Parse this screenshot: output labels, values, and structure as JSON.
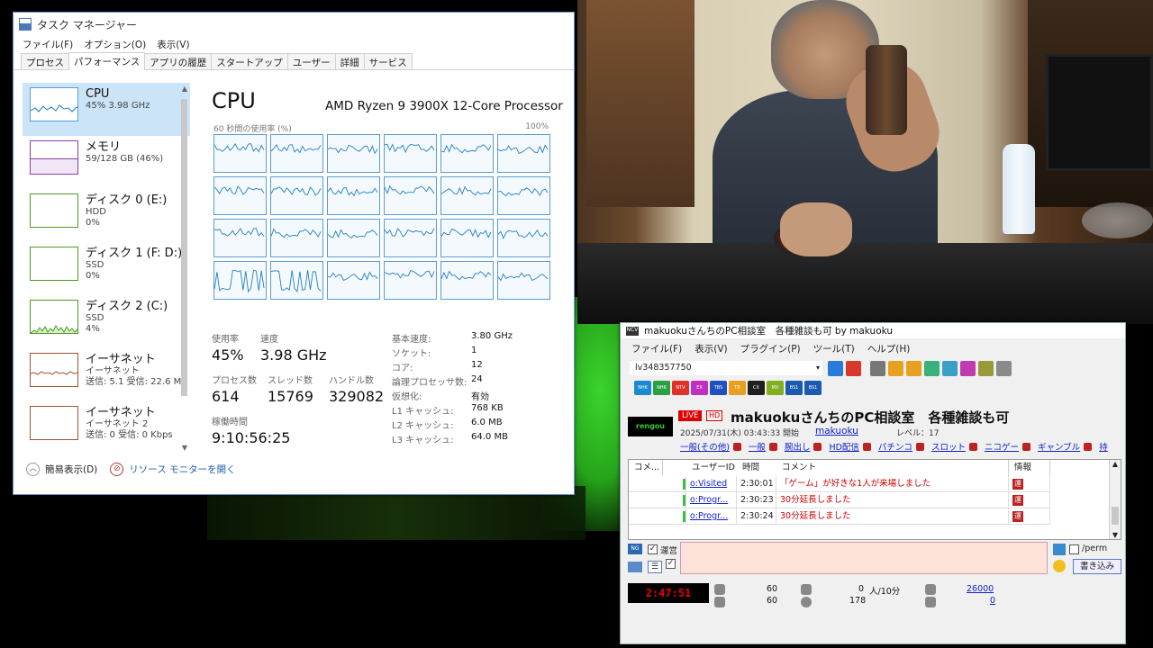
{
  "task_manager": {
    "title": "タスク マネージャー",
    "menu": [
      "ファイル(F)",
      "オプション(O)",
      "表示(V)"
    ],
    "tabs": [
      "プロセス",
      "パフォーマンス",
      "アプリの履歴",
      "スタートアップ",
      "ユーザー",
      "詳細",
      "サービス"
    ],
    "active_tab": "パフォーマンス",
    "sidebar": [
      {
        "title": "CPU",
        "sub1": "45%  3.98 GHz",
        "sub2": "",
        "sub3": "",
        "color": "#1f7ac0"
      },
      {
        "title": "メモリ",
        "sub1": "59/128 GB (46%)",
        "sub2": "",
        "sub3": "",
        "color": "#8b3ea8"
      },
      {
        "title": "ディスク 0 (E:)",
        "sub1": "HDD",
        "sub2": "0%",
        "sub3": "",
        "color": "#4b9a1f"
      },
      {
        "title": "ディスク 1 (F: D:)",
        "sub1": "SSD",
        "sub2": "0%",
        "sub3": "",
        "color": "#4b9a1f"
      },
      {
        "title": "ディスク 2 (C:)",
        "sub1": "SSD",
        "sub2": "4%",
        "sub3": "",
        "color": "#4b9a1f"
      },
      {
        "title": "イーサネット",
        "sub1": "イーサネット",
        "sub2": "送信: 5.1  受信: 22.6 M",
        "sub3": "",
        "color": "#a0522d"
      },
      {
        "title": "イーサネット",
        "sub1": "イーサネット 2",
        "sub2": "送信: 0  受信: 0 Kbps",
        "sub3": "",
        "color": "#a0522d"
      }
    ],
    "cpu": {
      "heading": "CPU",
      "processor": "AMD Ryzen 9 3900X 12-Core Processor",
      "graph_label": "60 秒間の使用率 (%)",
      "graph_max": "100%",
      "usage_label": "使用率",
      "usage": "45%",
      "speed_label": "速度",
      "speed": "3.98 GHz",
      "process_label": "プロセス数",
      "processes": "614",
      "thread_label": "スレッド数",
      "threads": "15769",
      "handle_label": "ハンドル数",
      "handles": "329082",
      "uptime_label": "稼働時間",
      "uptime": "9:10:56:25",
      "specs": [
        {
          "k": "基本速度:",
          "v": "3.80 GHz"
        },
        {
          "k": "ソケット:",
          "v": "1"
        },
        {
          "k": "コア:",
          "v": "12"
        },
        {
          "k": "論理プロセッサ数:",
          "v": "24"
        },
        {
          "k": "仮想化:",
          "v": "有効"
        },
        {
          "k": "L1 キャッシュ:",
          "v": "768 KB"
        },
        {
          "k": "L2 キャッシュ:",
          "v": "6.0 MB"
        },
        {
          "k": "L3 キャッシュ:",
          "v": "64.0 MB"
        }
      ]
    },
    "footer": {
      "less_details": "簡易表示(D)",
      "resource_monitor": "リソース モニターを開く"
    }
  },
  "nico": {
    "title": "makuokuさんちのPC相談室　各種雑談も可 by makuoku",
    "menu": [
      "ファイル(F)",
      "表示(V)",
      "プラグイン(P)",
      "ツール(T)",
      "ヘルプ(H)"
    ],
    "live_id": "lv348357750",
    "channels": [
      "NHK",
      "NHK",
      "NTV",
      "EX",
      "TBS",
      "TX",
      "CX",
      "MX",
      "BS1",
      "BS1"
    ],
    "live_badge": "LIVE",
    "hd_badge": "HD",
    "program_image_text": "rengou",
    "program_title": "makuokuさんちのPC相談室　各種雑談も可",
    "date": "2025/07/31(木) 03:43:33 開始",
    "owner": "makuoku",
    "level": "レベル：17",
    "tags": [
      "一般(その他)",
      "一般",
      "腕出し",
      "HD配信",
      "パチンコ",
      "スロット",
      "ニコゲー",
      "ギャンブル",
      "持"
    ],
    "table_headers": [
      "コメ...",
      "ユーザーID",
      "時間",
      "コメント",
      "情報"
    ],
    "rows": [
      {
        "user": "o:Visited",
        "time": "2:30:01",
        "comment": "「ゲーム」が好きな1人が来場しました",
        "info": "運"
      },
      {
        "user": "o:Progr...",
        "time": "2:30:23",
        "comment": "30分延長しました",
        "info": "運"
      },
      {
        "user": "o:Progr...",
        "time": "2:30:24",
        "comment": "30分延長しました",
        "info": "運"
      }
    ],
    "ng_label": "NG",
    "unei_label": "運営",
    "perm_label": "/perm",
    "submit_label": "書き込み",
    "elapsed": "2:47:51",
    "stat1": "60",
    "stat2": "60",
    "stat3": "0",
    "stat3_unit": "人/10分",
    "stat4": "178",
    "stat5": "26000",
    "stat6": "0"
  }
}
